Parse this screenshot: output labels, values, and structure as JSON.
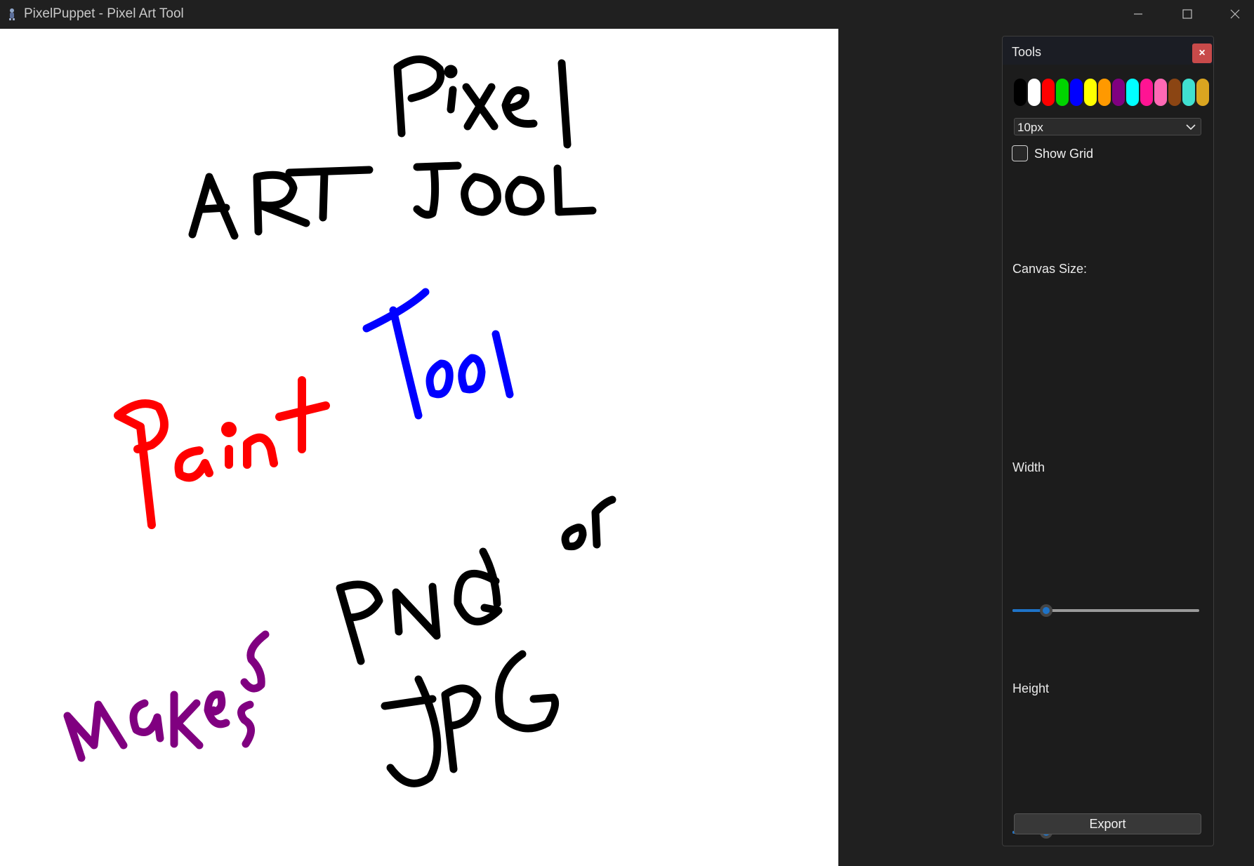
{
  "window": {
    "title": "PixelPuppet - Pixel Art Tool"
  },
  "panel": {
    "title": "Tools",
    "close_glyph": "×",
    "palette": [
      "#000000",
      "#ffffff",
      "#ff0000",
      "#00d400",
      "#0000ff",
      "#ffff00",
      "#ff9900",
      "#800080",
      "#00ffff",
      "#ff1493",
      "#ff69b4",
      "#8b4513",
      "#40e0d0",
      "#daa520"
    ],
    "brush_size": "10px",
    "show_grid_label": "Show Grid",
    "show_grid_checked": false,
    "canvas_size_label": "Canvas Size:",
    "width_label": "Width",
    "width_value_fraction": 0.18,
    "height_label": "Height",
    "height_value_fraction": 0.18,
    "export_label": "Export"
  },
  "colors": {
    "accent": "#1e73c8",
    "close": "#c84a4a",
    "canvas": "#ffffff",
    "ink_black": "#000000",
    "ink_red": "#ff0000",
    "ink_blue": "#0000ff",
    "ink_purple": "#800080"
  }
}
